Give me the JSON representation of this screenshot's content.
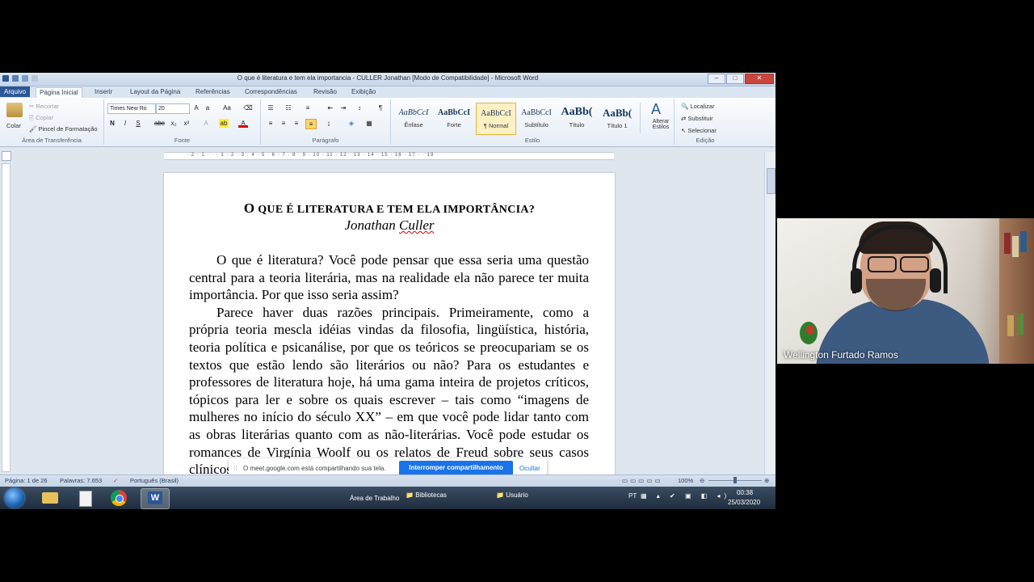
{
  "window": {
    "title": "O que é literatura e tem ela importancia - CULLER Jonathan [Modo de Compatibilidade] - Microsoft Word",
    "controls": [
      "–",
      "□",
      "✕"
    ]
  },
  "ribbon_tabs": [
    "Arquivo",
    "Página Inicial",
    "Inserir",
    "Layout da Página",
    "Referências",
    "Correspondências",
    "Revisão",
    "Exibição"
  ],
  "clipboard": {
    "paste": "Colar",
    "cut": "Recortar",
    "copy": "Copiar",
    "format_painter": "Pincel de Formatação",
    "label": "Área de Transferência"
  },
  "font": {
    "name": "Times New Ro",
    "size": "20",
    "label": "Fonte",
    "bold": "N",
    "italic": "I",
    "underline": "S",
    "strike": "abc",
    "subscript": "x₂",
    "superscript": "x²"
  },
  "paragraph": {
    "label": "Parágrafo"
  },
  "styles": {
    "label": "Estilo",
    "items": [
      {
        "sample": "AaBbCcI",
        "name": "Ênfase"
      },
      {
        "sample": "AaBbCcI",
        "name": "Forte"
      },
      {
        "sample": "AaBbCcI",
        "name": "¶ Normal"
      },
      {
        "sample": "AaBbCcI",
        "name": "Subtítulo"
      },
      {
        "sample": "AaBb(",
        "name": "Título"
      },
      {
        "sample": "AaBb(",
        "name": "Título 1"
      }
    ],
    "change_styles": "Alterar Estilos"
  },
  "editing": {
    "label": "Edição",
    "find": "Localizar",
    "replace": "Substituir",
    "select": "Selecionar"
  },
  "ruler": {
    "ticks": "· 2 · 1 · · · 1 · 2 · 3 · 4 · 5 · 6 · 7 · 8 · 9 · 10 · 11 · 12 · 13 · 14 · 15 · 16 · 17 · · 19 ·"
  },
  "document": {
    "title_first": "O",
    "title_rest": " QUE É LITERATURA E TEM ELA IMPORTÂNCIA?",
    "author_first": "Jonathan ",
    "author_last": "Culler",
    "paragraphs": [
      "O que é literatura? Você pode pensar que essa seria uma questão central para a teoria literária, mas na realidade ela não parece ter muita importância. Por que isso seria assim?",
      "Parece haver duas razões principais. Primeiramente, como a própria teoria mescla idéias vindas da filosofia, lingüística, história, teoria política e psicanálise, por que os teóricos se preocupariam se os textos que estão lendo são literários ou não? Para os estudantes e professores de literatura hoje, há uma gama inteira de projetos críticos, tópicos para ler e sobre os quais escrever – tais como “imagens de mulheres no início do século XX” – em que você pode lidar tanto com as obras literárias quanto com as não-literárias. Você pode estudar os romances de Virgínia Woolf ou os relatos de Freud sobre seus casos clínicos, e a"
    ]
  },
  "statusbar": {
    "page": "Página: 1 de 26",
    "words": "Palavras: 7.653",
    "language": "Português (Brasil)",
    "zoom": "100%"
  },
  "share_banner": {
    "message": "O meet.google.com está compartilhando sua tela.",
    "stop_button": "Interromper compartilhamento",
    "hide_link": "Ocultar"
  },
  "taskbar": {
    "desktop": "Área de Trabalho",
    "libraries": "Bibliotecas",
    "user": "Usuário",
    "lang": "PT",
    "time": "00:38",
    "date": "25/03/2020"
  },
  "video": {
    "participant_name": "Wellington Furtado Ramos"
  }
}
